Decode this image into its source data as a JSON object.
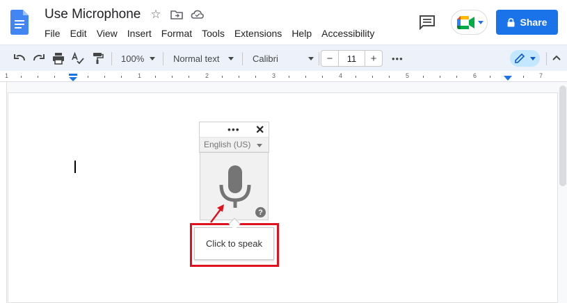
{
  "document": {
    "title": "Use Microphone",
    "title_icons": [
      "star-icon",
      "move-to-folder-icon",
      "cloud-status-icon"
    ]
  },
  "menubar": {
    "items": [
      "File",
      "Edit",
      "View",
      "Insert",
      "Format",
      "Tools",
      "Extensions",
      "Help",
      "Accessibility"
    ]
  },
  "header": {
    "share_label": "Share",
    "share_icon": "lock-icon",
    "brand_color": "#1a73e8"
  },
  "toolbar": {
    "zoom": "100%",
    "style": "Normal text",
    "font": "Calibri",
    "font_size": "11",
    "minus": "−",
    "plus": "+",
    "more": "•••"
  },
  "ruler": {
    "numbers": [
      "1",
      "1",
      "2",
      "3",
      "4",
      "5",
      "6",
      "7"
    ]
  },
  "voice_typing": {
    "menu": "•••",
    "close": "✕",
    "language": "English (US)",
    "help": "?",
    "tooltip": "Click to speak",
    "highlight_color": "#e0101e"
  }
}
